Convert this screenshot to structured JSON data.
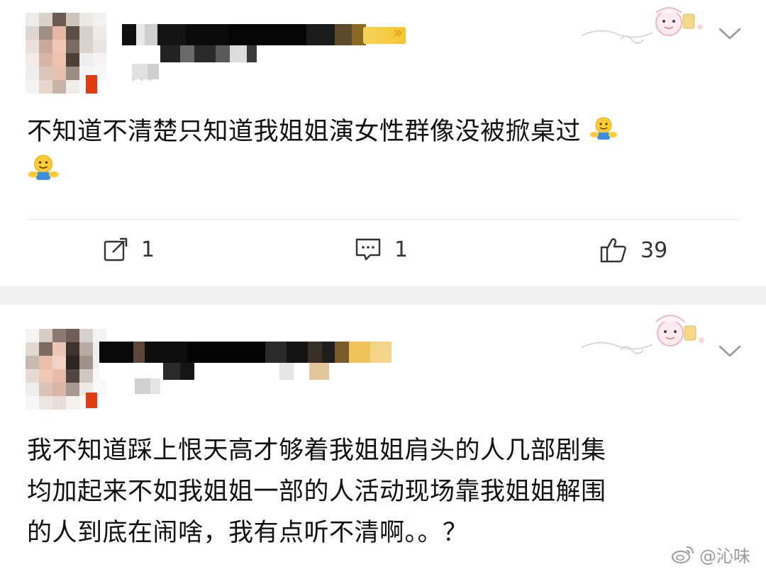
{
  "posts": [
    {
      "content_line1": "不知道不清楚只知道我姐姐演女性群像没被掀桌过",
      "actions": [
        {
          "icon": "repost-icon",
          "count": "1"
        },
        {
          "icon": "comment-icon",
          "count": "1"
        },
        {
          "icon": "like-icon",
          "count": "39"
        }
      ]
    },
    {
      "content_lines": [
        "我不知道踩上恨天高才够着我姐姐肩头的人几部剧集",
        "均加起来不如我姐姐一部的人活动现场靠我姐姐解围",
        "的人到底在闹啥，我有点听不清啊。。？"
      ]
    }
  ],
  "watermark": {
    "icon": "weibo-logo-icon",
    "text": "@沁味"
  },
  "colors": {
    "background": "#ffffff",
    "separator": "#f0f0f0",
    "text": "#111111",
    "muted": "#9a9a9a"
  }
}
